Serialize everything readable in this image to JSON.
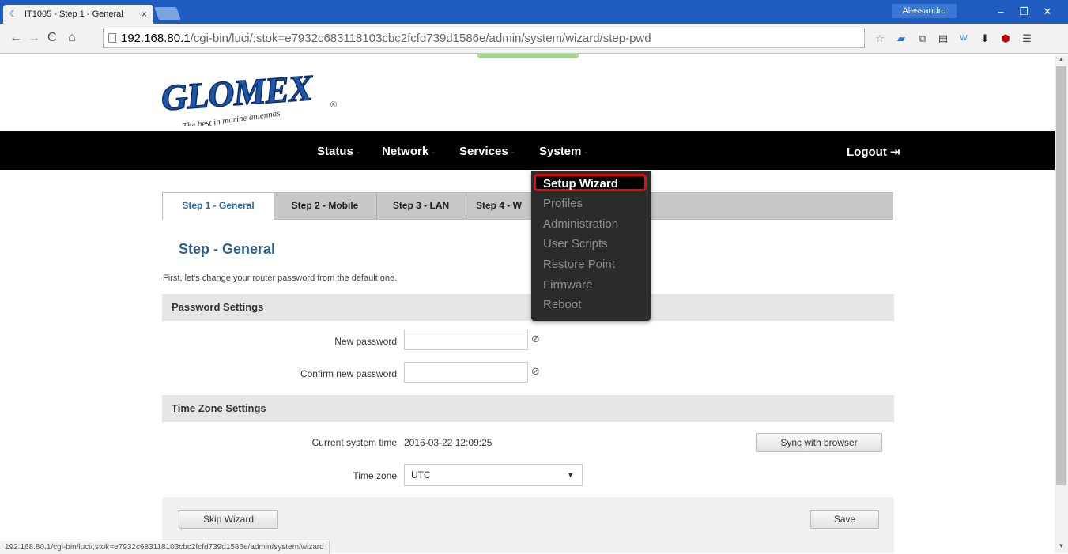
{
  "browser": {
    "tab_title": "IT1005 - Step 1 - General",
    "tab_close": "×",
    "user": "Alessandro",
    "url_host": "192.168.80.1",
    "url_path": "/cgi-bin/luci/;stok=e7932c683118103cbc2fcfd739d1586e/admin/system/wizard/step-pwd",
    "status_url": "192.168.80.1/cgi-bin/luci/;stok=e7932c683118103cbc2fcfd739d1586e/admin/system/wizard"
  },
  "logo": {
    "brand": "GLOMEX",
    "tagline": "The best in marine antennas",
    "registered": "®"
  },
  "nav": {
    "items": [
      "Status",
      "Network",
      "Services",
      "System"
    ],
    "caret": "-",
    "logout": "Logout"
  },
  "system_menu": {
    "items": [
      "Setup Wizard",
      "Profiles",
      "Administration",
      "User Scripts",
      "Restore Point",
      "Firmware",
      "Reboot"
    ],
    "selected": "Setup Wizard"
  },
  "steps": [
    "Step 1 - General",
    "Step 2 - Mobile",
    "Step 3 - LAN",
    "Step 4 - W"
  ],
  "page": {
    "heading": "Step - General",
    "intro": "First, let's change your router password from the default one.",
    "password_section": "Password Settings",
    "new_password_label": "New password",
    "confirm_password_label": "Confirm new password",
    "new_password_value": "",
    "confirm_password_value": "",
    "timezone_section": "Time Zone Settings",
    "current_time_label": "Current system time",
    "current_time_value": "2016-03-22 12:09:25",
    "sync_button": "Sync with browser",
    "timezone_label": "Time zone",
    "timezone_value": "UTC",
    "skip_button": "Skip Wizard",
    "save_button": "Save"
  },
  "icons": {
    "eye": "eye-slash-icon",
    "logout": "logout-icon"
  }
}
